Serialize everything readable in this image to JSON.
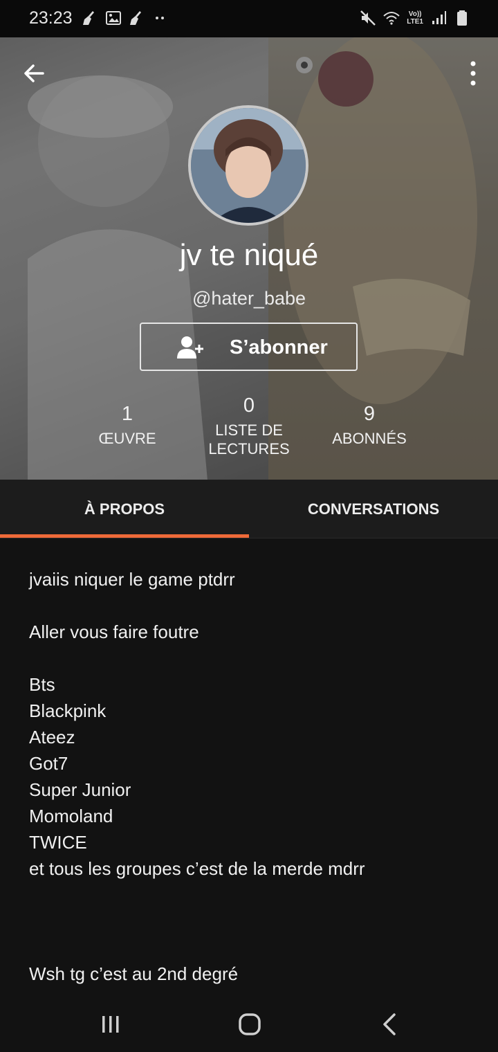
{
  "status_bar": {
    "time": "23:23",
    "left_icons": [
      "broom-icon",
      "image-icon",
      "broom-icon",
      "more-dots-icon"
    ],
    "right_icons": [
      "mute-icon",
      "wifi-icon",
      "volte-icon",
      "signal-icon",
      "battery-icon"
    ],
    "volte_label": "Vo))",
    "lte_label": "LTE1"
  },
  "header": {
    "back_icon": "arrow-left-icon",
    "menu_icon": "more-vertical-icon",
    "display_name": "jv te niqué",
    "username": "@hater_babe",
    "follow_button": {
      "icon": "add-person-icon",
      "label": "S’abonner"
    },
    "stats": {
      "works": {
        "value": "1",
        "label": "ŒUVRE"
      },
      "reading_lists": {
        "value": "0",
        "label_line1": "LISTE DE",
        "label_line2": "LECTURES"
      },
      "followers": {
        "value": "9",
        "label": "ABONNÉS"
      }
    }
  },
  "tabs": {
    "about": "À PROPOS",
    "conversations": "CONVERSATIONS",
    "active": "about",
    "accent_color": "#ef6a39"
  },
  "bio": {
    "lines": [
      "jvaiis niquer le game ptdrr",
      "",
      "Aller vous faire foutre",
      "",
      "Bts",
      "Blackpink",
      "Ateez",
      "Got7",
      "Super Junior",
      "Momoland",
      "TWICE",
      "et tous les groupes c’est de la merde mdrr",
      "",
      "",
      "",
      "Wsh tg c’est au 2nd degré"
    ]
  },
  "nav_bar": {
    "icons": [
      "recent-apps-icon",
      "home-icon",
      "back-icon"
    ]
  }
}
